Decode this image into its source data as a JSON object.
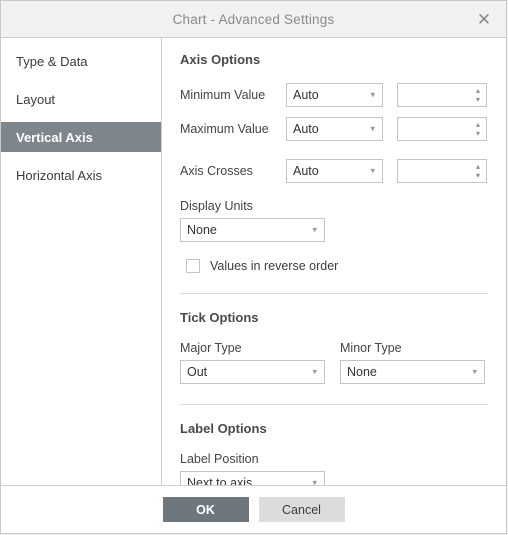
{
  "dialog": {
    "title": "Chart - Advanced Settings",
    "close_icon": "close-icon"
  },
  "sidebar": {
    "items": [
      {
        "label": "Type & Data",
        "selected": false
      },
      {
        "label": "Layout",
        "selected": false
      },
      {
        "label": "Vertical Axis",
        "selected": true
      },
      {
        "label": "Horizontal Axis",
        "selected": false
      }
    ]
  },
  "axis_options": {
    "heading": "Axis Options",
    "rows": [
      {
        "label": "Minimum Value",
        "select_value": "Auto",
        "spin_value": ""
      },
      {
        "label": "Maximum Value",
        "select_value": "Auto",
        "spin_value": ""
      },
      {
        "label": "Axis Crosses",
        "select_value": "Auto",
        "spin_value": ""
      }
    ],
    "display_units": {
      "label": "Display Units",
      "value": "None"
    },
    "reverse_order": {
      "label": "Values in reverse order",
      "checked": false
    }
  },
  "tick_options": {
    "heading": "Tick Options",
    "major": {
      "label": "Major Type",
      "value": "Out"
    },
    "minor": {
      "label": "Minor Type",
      "value": "None"
    }
  },
  "label_options": {
    "heading": "Label Options",
    "position": {
      "label": "Label Position",
      "value": "Next to axis"
    }
  },
  "footer": {
    "ok_label": "OK",
    "cancel_label": "Cancel"
  },
  "colors": {
    "accent": "#6f777e",
    "selected_item": "#7e868d",
    "titlebar_bg": "#f1f1f1",
    "border": "#c8c8c8"
  }
}
